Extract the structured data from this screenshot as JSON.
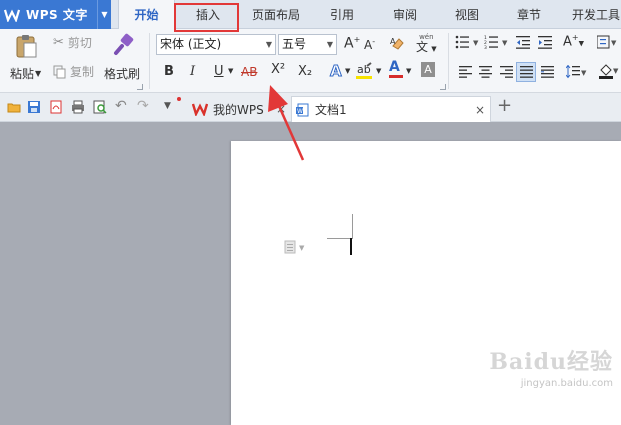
{
  "app": {
    "name": "WPS 文字",
    "brand_color": "#3a78d3"
  },
  "menu": {
    "tabs": [
      {
        "label": "开始"
      },
      {
        "label": "插入"
      },
      {
        "label": "页面布局"
      },
      {
        "label": "引用"
      },
      {
        "label": "审阅"
      },
      {
        "label": "视图"
      },
      {
        "label": "章节"
      },
      {
        "label": "开发工具"
      }
    ],
    "active_tab": "开始",
    "highlighted_tab": "插入",
    "highlight_color": "#e23838"
  },
  "ribbon": {
    "paste_label": "粘贴",
    "cut_label": "剪切",
    "copy_label": "复制",
    "format_painter_label": "格式刷",
    "font_name": "宋体 (正文)",
    "font_size": "五号",
    "bold": "B",
    "italic": "I",
    "underline": "U",
    "strike": "AB",
    "superscript": "X²",
    "subscript": "X₂",
    "text_effect": "A",
    "font_color": "A",
    "char_shade": "A",
    "phonetic": "文"
  },
  "quickbar": {
    "doc_tabs": [
      {
        "label": "我的WPS"
      },
      {
        "label": "文档1"
      }
    ]
  },
  "watermark": {
    "line1": "Baidu经验",
    "line2": "jingyan.baidu.com"
  },
  "annotation": {
    "arrow_color": "#e23838"
  }
}
